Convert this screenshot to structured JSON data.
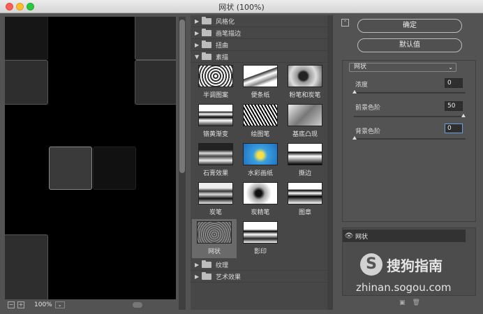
{
  "window": {
    "title": "网状 (100%)"
  },
  "preview": {
    "zoom": "100%"
  },
  "gallery": {
    "categories_top": [
      {
        "label": "风格化",
        "expanded": false
      },
      {
        "label": "画笔描边",
        "expanded": false
      },
      {
        "label": "扭曲",
        "expanded": false
      },
      {
        "label": "素描",
        "expanded": true
      }
    ],
    "filters": [
      {
        "label": "半调图案",
        "icon": "halftone-thumb"
      },
      {
        "label": "便条纸",
        "icon": "notepaper-thumb"
      },
      {
        "label": "粉笔和炭笔",
        "icon": "chalk-charcoal-thumb"
      },
      {
        "label": "铬黄渐变",
        "icon": "chrome-thumb"
      },
      {
        "label": "绘图笔",
        "icon": "graphic-pen-thumb"
      },
      {
        "label": "基底凸现",
        "icon": "bas-relief-thumb"
      },
      {
        "label": "石膏效果",
        "icon": "plaster-thumb"
      },
      {
        "label": "水彩画纸",
        "icon": "water-paper-thumb"
      },
      {
        "label": "撕边",
        "icon": "torn-edges-thumb"
      },
      {
        "label": "炭笔",
        "icon": "charcoal-thumb"
      },
      {
        "label": "炭精笔",
        "icon": "conte-crayon-thumb"
      },
      {
        "label": "图章",
        "icon": "stamp-thumb"
      },
      {
        "label": "网状",
        "icon": "reticulation-thumb",
        "selected": true
      },
      {
        "label": "影印",
        "icon": "photocopy-thumb"
      }
    ],
    "categories_bottom": [
      {
        "label": "纹理",
        "expanded": false
      },
      {
        "label": "艺术效果",
        "expanded": false
      }
    ]
  },
  "buttons": {
    "ok": "确定",
    "default": "默认值"
  },
  "filter_select": {
    "value": "网状"
  },
  "params": [
    {
      "label": "浓度",
      "value": "0",
      "level": 0.0
    },
    {
      "label": "前景色阶",
      "value": "50",
      "level": 1.0
    },
    {
      "label": "背景色阶",
      "value": "0",
      "level": 0.0
    }
  ],
  "layer": {
    "name": "网状"
  },
  "watermark": {
    "brand": "搜狗指南",
    "url": "zhinan.sogou.com",
    "logo_letter": "S"
  }
}
